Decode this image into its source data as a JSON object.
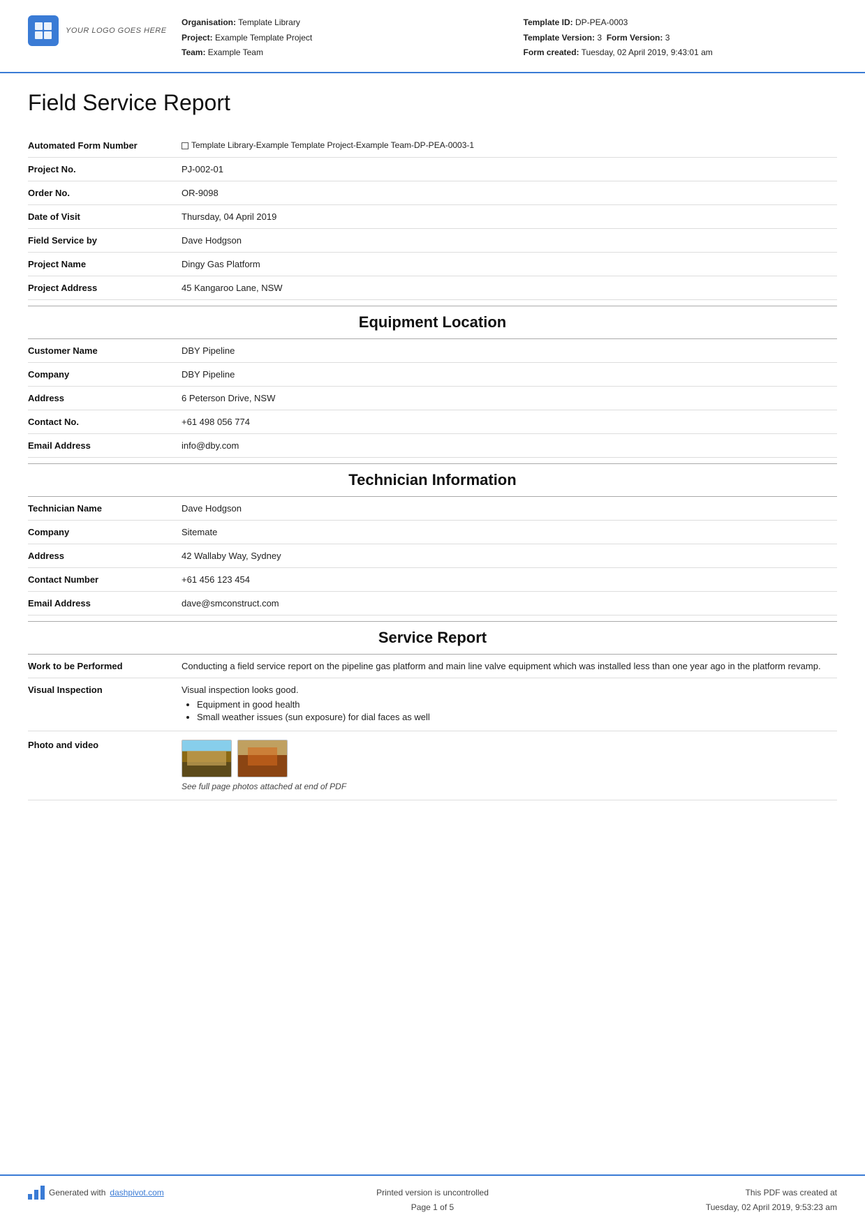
{
  "header": {
    "logo_text": "YOUR LOGO GOES HERE",
    "organisation_label": "Organisation:",
    "organisation_value": "Template Library",
    "project_label": "Project:",
    "project_value": "Example Template Project",
    "team_label": "Team:",
    "team_value": "Example Team",
    "template_id_label": "Template ID:",
    "template_id_value": "DP-PEA-0003",
    "template_version_label": "Template Version:",
    "template_version_value": "3",
    "form_version_label": "Form Version:",
    "form_version_value": "3",
    "form_created_label": "Form created:",
    "form_created_value": "Tuesday, 02 April 2019, 9:43:01 am"
  },
  "page_title": "Field Service Report",
  "fields": {
    "automated_form_number_label": "Automated Form Number",
    "automated_form_number_value": "Template Library-Example Template Project-Example Team-DP-PEA-0003-1",
    "project_no_label": "Project No.",
    "project_no_value": "PJ-002-01",
    "order_no_label": "Order No.",
    "order_no_value": "OR-9098",
    "date_of_visit_label": "Date of Visit",
    "date_of_visit_value": "Thursday, 04 April 2019",
    "field_service_by_label": "Field Service by",
    "field_service_by_value": "Dave Hodgson",
    "project_name_label": "Project Name",
    "project_name_value": "Dingy Gas Platform",
    "project_address_label": "Project Address",
    "project_address_value": "45 Kangaroo Lane, NSW"
  },
  "sections": {
    "equipment_location": {
      "title": "Equipment Location",
      "customer_name_label": "Customer Name",
      "customer_name_value": "DBY Pipeline",
      "company_label": "Company",
      "company_value": "DBY Pipeline",
      "address_label": "Address",
      "address_value": "6 Peterson Drive, NSW",
      "contact_no_label": "Contact No.",
      "contact_no_value": "+61 498 056 774",
      "email_label": "Email Address",
      "email_value": "info@dby.com"
    },
    "technician_information": {
      "title": "Technician Information",
      "technician_name_label": "Technician Name",
      "technician_name_value": "Dave Hodgson",
      "company_label": "Company",
      "company_value": "Sitemate",
      "address_label": "Address",
      "address_value": "42 Wallaby Way, Sydney",
      "contact_number_label": "Contact Number",
      "contact_number_value": "+61 456 123 454",
      "email_label": "Email Address",
      "email_value": "dave@smconstruct.com"
    },
    "service_report": {
      "title": "Service Report",
      "work_label": "Work to be Performed",
      "work_value": "Conducting a field service report on the pipeline gas platform and main line valve equipment which was installed less than one year ago in the platform revamp.",
      "visual_inspection_label": "Visual Inspection",
      "visual_inspection_value": "Visual inspection looks good.",
      "visual_bullets": [
        "Equipment in good health",
        "Small weather issues (sun exposure) for dial faces as well"
      ],
      "photo_label": "Photo and video",
      "photo_caption": "See full page photos attached at end of PDF"
    }
  },
  "footer": {
    "generated_text": "Generated with ",
    "generated_link": "dashpivot.com",
    "uncontrolled_text": "Printed version is uncontrolled",
    "page_text": "Page 1 of 5",
    "pdf_created_text": "This PDF was created at",
    "pdf_created_date": "Tuesday, 02 April 2019, 9:53:23 am"
  }
}
